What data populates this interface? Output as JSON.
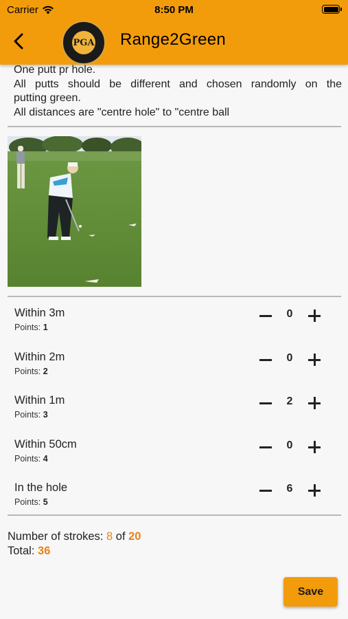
{
  "status_bar": {
    "carrier": "Carrier",
    "time": "8:50 PM"
  },
  "header": {
    "title": "Range2Green",
    "logo_text": "PGA",
    "back_icon": "chevron-left-icon"
  },
  "description": {
    "line1": "One putt pr hole.",
    "line2a": "All putts should be different and chosen randomly on the",
    "line2b": "putting green.",
    "line3": "All distances are \"centre hole\" to \"centre ball"
  },
  "points_label": "Points:",
  "rows": [
    {
      "label": "Within 3m",
      "points": "1",
      "count": "0"
    },
    {
      "label": "Within 2m",
      "points": "2",
      "count": "0"
    },
    {
      "label": "Within 1m",
      "points": "3",
      "count": "2"
    },
    {
      "label": "Within 50cm",
      "points": "4",
      "count": "0"
    },
    {
      "label": "In the hole",
      "points": "5",
      "count": "6"
    }
  ],
  "summary": {
    "strokes_label": "Number of strokes:",
    "strokes_value": "8",
    "of_label": "of",
    "strokes_total": "20",
    "total_label": "Total:",
    "total_value": "36"
  },
  "save_label": "Save",
  "colors": {
    "accent": "#f39c0b",
    "highlight": "#e9821a"
  }
}
